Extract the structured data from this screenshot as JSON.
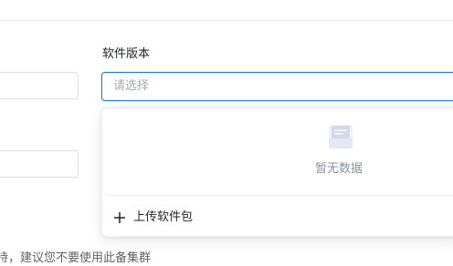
{
  "form": {
    "version_label": "软件版本",
    "version_placeholder": "请选择"
  },
  "dropdown": {
    "empty_text": "暂无数据",
    "upload_label": "上传软件包"
  },
  "footer": {
    "partial_text": "持，建议您不要使用此备集群"
  },
  "icons": {
    "empty": "empty-box-icon",
    "plus": "plus-icon"
  },
  "colors": {
    "accent": "#1677ff",
    "placeholder": "#a8abb2",
    "muted": "#8a919f"
  }
}
